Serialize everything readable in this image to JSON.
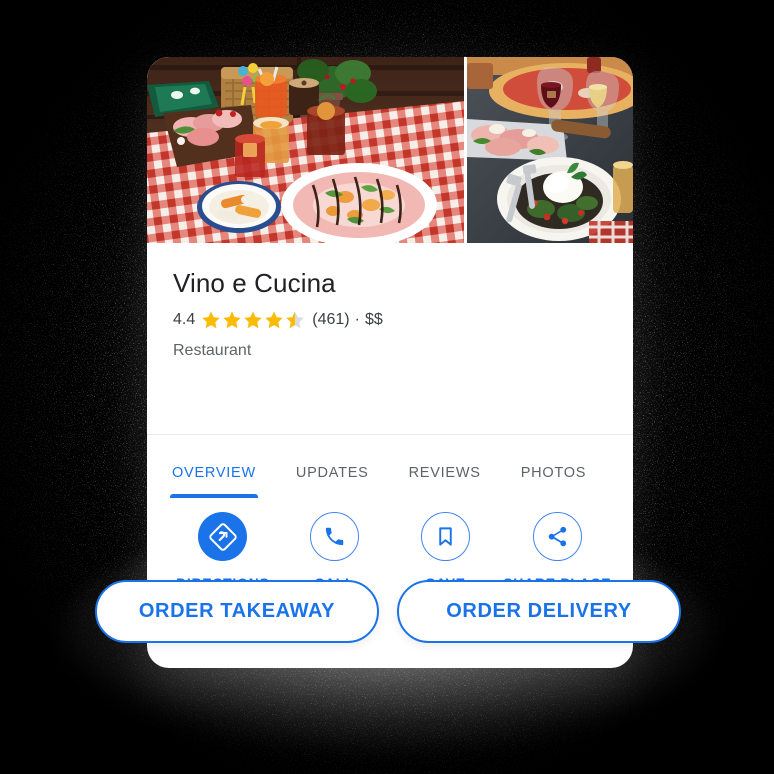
{
  "place": {
    "name": "Vino e Cucina",
    "rating": "4.4",
    "rating_stars": 4.5,
    "review_count": "(461)",
    "separator": "·",
    "price_level": "$$",
    "category": "Restaurant"
  },
  "photos": [
    {
      "name": "photo-food-table",
      "alt": "Italian sharing table with red gingham tablecloth, charcuterie, cocktails and picnic basket"
    },
    {
      "name": "photo-burrata-wine",
      "alt": "Burrata salad bowl with red and white wine glasses and pizza"
    }
  ],
  "tabs": [
    {
      "label": "OVERVIEW",
      "active": true
    },
    {
      "label": "UPDATES",
      "active": false
    },
    {
      "label": "REVIEWS",
      "active": false
    },
    {
      "label": "PHOTOS",
      "active": false
    }
  ],
  "actions": [
    {
      "label": "DIRECTIONS",
      "icon": "directions-icon",
      "style": "filled"
    },
    {
      "label": "CALL",
      "icon": "phone-icon",
      "style": "outlined"
    },
    {
      "label": "SAVE",
      "icon": "bookmark-icon",
      "style": "outlined"
    },
    {
      "label": "SHARE PLACE",
      "icon": "share-icon",
      "style": "outlined"
    }
  ],
  "order_buttons": [
    {
      "label": "ORDER TAKEAWAY"
    },
    {
      "label": "ORDER DELIVERY"
    }
  ],
  "colors": {
    "accent_blue": "#1a73e8",
    "outline_blue": "#4285f4",
    "star_gold": "#fabb05",
    "star_grey": "#dadce0",
    "title_text": "#202124",
    "secondary_text": "#5f6368",
    "card_bg": "#ffffff",
    "backdrop": "#000000"
  }
}
